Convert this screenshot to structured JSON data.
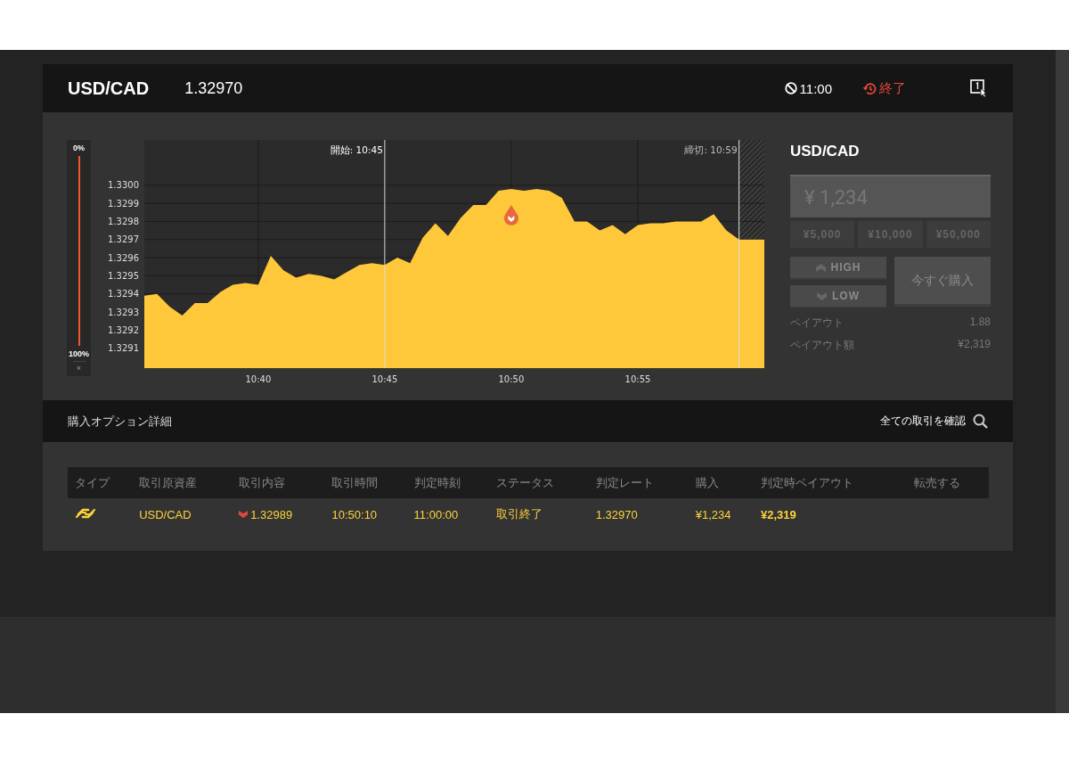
{
  "header": {
    "pair": "USD/CAD",
    "rate": "1.32970",
    "expiry": "11:00",
    "status": "終了"
  },
  "gauge": {
    "top_label": "0%",
    "bottom_label": "100%",
    "close": "×"
  },
  "chart": {
    "chart_data": {
      "type": "area",
      "ylim": [
        1.32899,
        1.33025
      ],
      "grid": true,
      "categories": [
        null,
        null,
        null,
        null,
        null,
        null,
        null,
        null,
        null,
        "10:40",
        null,
        null,
        null,
        null,
        null,
        null,
        null,
        null,
        null,
        "10:45",
        null,
        null,
        null,
        null,
        null,
        null,
        null,
        null,
        null,
        "10:50",
        null,
        null,
        null,
        null,
        null,
        null,
        null,
        null,
        null,
        "10:55",
        null,
        null,
        null,
        null,
        null,
        null,
        null,
        null,
        null,
        null
      ],
      "yticks": [
        {
          "value": 1.3291,
          "label": "1.3291"
        },
        {
          "value": 1.3292,
          "label": "1.3292"
        },
        {
          "value": 1.3293,
          "label": "1.3293"
        },
        {
          "value": 1.3294,
          "label": "1.3294"
        },
        {
          "value": 1.3295,
          "label": "1.3295"
        },
        {
          "value": 1.3296,
          "label": "1.3296"
        },
        {
          "value": 1.3297,
          "label": "1.3297"
        },
        {
          "value": 1.3298,
          "label": "1.3298"
        },
        {
          "value": 1.3299,
          "label": "1.3299"
        },
        {
          "value": 1.33,
          "label": "1.3300"
        }
      ],
      "series": [
        {
          "color": "#ffc83a",
          "values": [
            1.32939,
            1.3294,
            1.32933,
            1.32928,
            1.32935,
            1.32935,
            1.32941,
            1.32945,
            1.32946,
            1.32945,
            1.32961,
            1.32953,
            1.32949,
            1.32951,
            1.3295,
            1.32948,
            1.32952,
            1.32956,
            1.32957,
            1.32956,
            1.3296,
            1.32957,
            1.32971,
            1.32979,
            1.32972,
            1.32982,
            1.32989,
            1.32989,
            1.32997,
            1.32998,
            1.32997,
            1.32998,
            1.32997,
            1.32993,
            1.3298,
            1.3298,
            1.32975,
            1.32978,
            1.32973,
            1.32978,
            1.32979,
            1.32979,
            1.3298,
            1.3298,
            1.3298,
            1.32984,
            1.32975,
            1.3297,
            1.3297,
            1.3297
          ]
        }
      ],
      "annotations": [
        "開始: 10:45",
        "締切: 10:59"
      ]
    }
  },
  "order": {
    "pair": "USD/CAD",
    "amount": "¥ 1,234",
    "presets": [
      "¥5,000",
      "¥10,000",
      "¥50,000"
    ],
    "high": "HIGH",
    "low": "LOW",
    "buy": "今すぐ購入",
    "disabled": true,
    "payout_rows": [
      {
        "label": "ペイアウト",
        "value": "1.88"
      },
      {
        "label": "ペイアウト額",
        "value": "¥2,319"
      }
    ]
  },
  "details": {
    "title": "購入オプション詳細",
    "link": "全ての取引を確認",
    "table": {
      "columns": [
        "タイプ",
        "取引原資産",
        "取引内容",
        "取引時間",
        "判定時刻",
        "ステータス",
        "判定レート",
        "購入",
        "判定時ペイアウト",
        "転売する"
      ],
      "rows": [
        {
          "asset": "USD/CAD",
          "kind": "low",
          "content": "1.32989",
          "time": "10:50:10",
          "expiry": "11:00:00",
          "status": "取引終了",
          "rate": "1.32970",
          "amount": "¥1,234",
          "payout": "¥2,319"
        }
      ]
    }
  }
}
